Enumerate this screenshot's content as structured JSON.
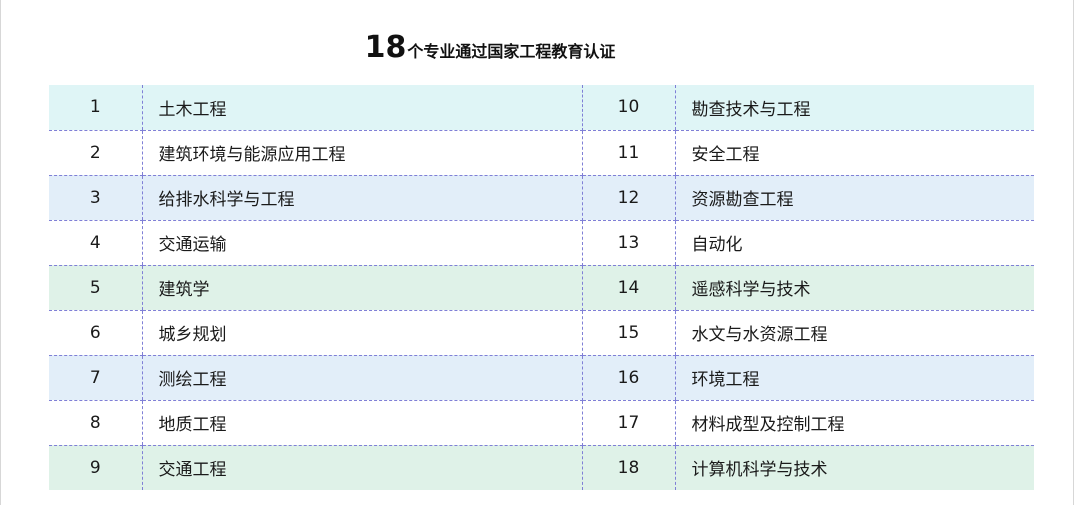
{
  "title": {
    "number": "18",
    "text": "个专业通过国家工程教育认证"
  },
  "rows": [
    {
      "left": {
        "index": "1",
        "name": "土木工程"
      },
      "right": {
        "index": "10",
        "name": "勘查技术与工程"
      },
      "bg": "cyan"
    },
    {
      "left": {
        "index": "2",
        "name": "建筑环境与能源应用工程"
      },
      "right": {
        "index": "11",
        "name": "安全工程"
      },
      "bg": "white"
    },
    {
      "left": {
        "index": "3",
        "name": "给排水科学与工程"
      },
      "right": {
        "index": "12",
        "name": "资源勘查工程"
      },
      "bg": "blue"
    },
    {
      "left": {
        "index": "4",
        "name": "交通运输"
      },
      "right": {
        "index": "13",
        "name": "自动化"
      },
      "bg": "white"
    },
    {
      "left": {
        "index": "5",
        "name": "建筑学"
      },
      "right": {
        "index": "14",
        "name": "遥感科学与技术"
      },
      "bg": "green"
    },
    {
      "left": {
        "index": "6",
        "name": "城乡规划"
      },
      "right": {
        "index": "15",
        "name": "水文与水资源工程"
      },
      "bg": "white"
    },
    {
      "left": {
        "index": "7",
        "name": "测绘工程"
      },
      "right": {
        "index": "16",
        "name": "环境工程"
      },
      "bg": "blue"
    },
    {
      "left": {
        "index": "8",
        "name": "地质工程"
      },
      "right": {
        "index": "17",
        "name": "材料成型及控制工程"
      },
      "bg": "white"
    },
    {
      "left": {
        "index": "9",
        "name": "交通工程"
      },
      "right": {
        "index": "18",
        "name": "计算机科学与技术"
      },
      "bg": "green"
    }
  ],
  "colors": {
    "cyan": "#dff5f6",
    "white": "#ffffff",
    "blue": "#e2eef9",
    "green": "#dff2e8",
    "divider": "#7f7fd6"
  }
}
